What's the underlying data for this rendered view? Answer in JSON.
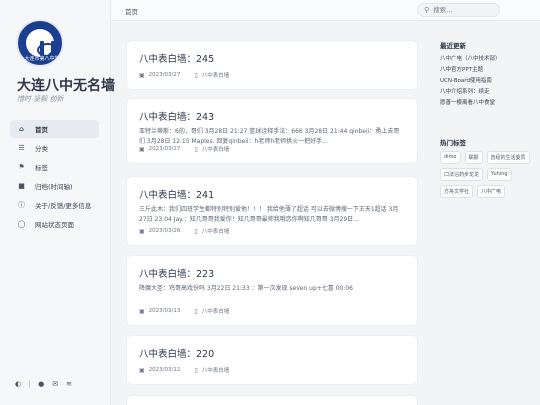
{
  "colors": {
    "brand": "#1a3f91",
    "active_nav_bg": "#e7ebf0",
    "page_bg": "#f3f4f6"
  },
  "sidebar": {
    "logo_text": "大连市第八中学",
    "title": "大连八中无名墙",
    "subtitle": "惜时 坚毅 创新",
    "items": [
      {
        "label": "首页",
        "icon": "home-icon"
      },
      {
        "label": "分类",
        "icon": "list-icon"
      },
      {
        "label": "标签",
        "icon": "tag-icon"
      },
      {
        "label": "归档(时间轴)",
        "icon": "archive-icon"
      },
      {
        "label": "关于/反馈/更多信息",
        "icon": "info-icon"
      },
      {
        "label": "网站状态页面",
        "icon": "globe-icon"
      }
    ],
    "footer_icons": [
      "theme-toggle-icon",
      "github-icon",
      "email-icon",
      "rss-icon"
    ]
  },
  "header": {
    "breadcrumb": "首页",
    "search_placeholder": "搜索..."
  },
  "posts": [
    {
      "title": "八中表白墙：245",
      "excerpt": "",
      "date": "2023/03/27",
      "category": "八中表白墙"
    },
    {
      "title": "八中表白墙：243",
      "excerpt": "亚特兰蒂斯：6的，哥们 3月28日 21:27 篮球诠释手法：666 3月28日 21:44 qinbeii：勇上去哥们 3月28日 12:15 Maples. 回复qinbeii：h老师h老师拱火一把好手...",
      "date": "2023/03/27",
      "category": "八中表白墙"
    },
    {
      "title": "八中表白墙：241",
      "excerpt": "三斤此木：我们四班学生都特别特别爱他！！！ 我给他薄了超话 可以去微博搜一下王天1超话 3月27日 23:04 Jay.：知几哥哥我爱你！知几哥哥最帅我哦恋你啊知几哥哥 3月29日...",
      "date": "2023/03/26",
      "category": "八中表白墙"
    },
    {
      "title": "八中表白墙：223",
      "excerpt": "降魔大圣：鸡哥高戏份吗 3月22日 21:33                                                   ：第一次发现 seven up+七喜 00:06",
      "date": "2023/03/13",
      "category": "八中表白墙"
    },
    {
      "title": "八中表白墙：220",
      "excerpt": "",
      "date": "2023/03/12",
      "category": "八中表白墙"
    }
  ],
  "right": {
    "recent_title": "最近更新",
    "recent": [
      "八中广电（八中技术部）",
      "八中官方PPT主题",
      "UCN-Board使用指南",
      "八中介绍系列：续走",
      "愿善一樱离看八中食堂"
    ],
    "tags_title": "热门标签",
    "tags": [
      "dimo",
      "联报",
      "曾经的生活委员",
      "口法沾药步龙龙",
      "Yuhing",
      "方舟文学社",
      "八中广电"
    ]
  }
}
